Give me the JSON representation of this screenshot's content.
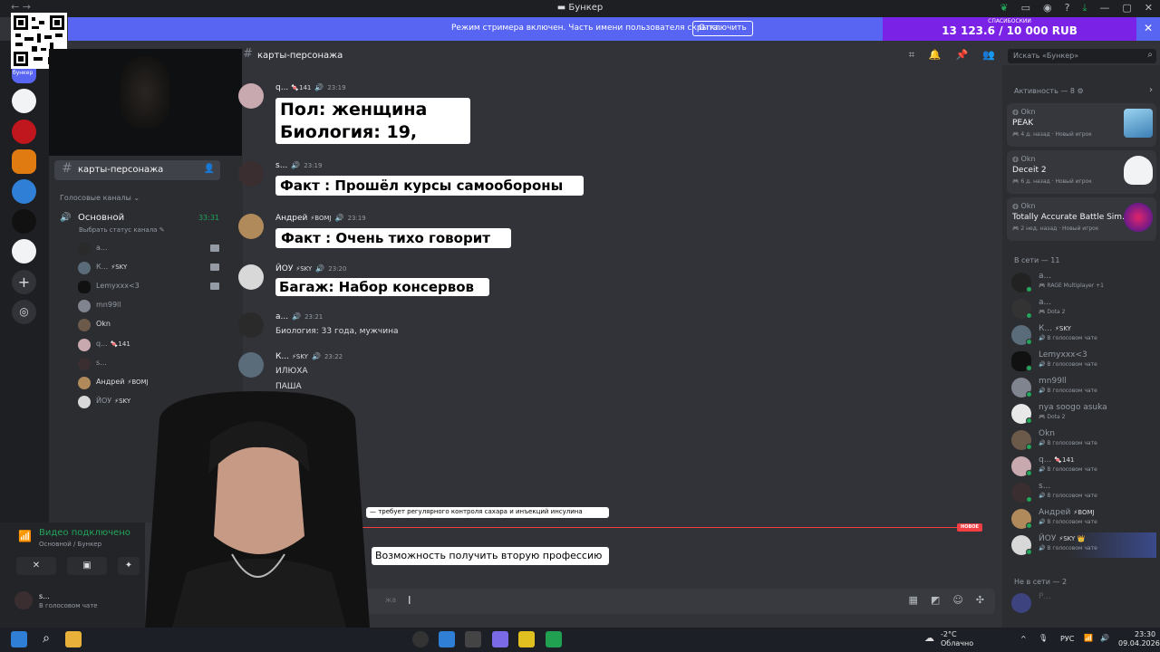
{
  "window": {
    "title": "Бункер"
  },
  "banner": {
    "text": "Режим стримера включен. Часть имени пользователя скрыта.",
    "button": "Отключить"
  },
  "donation": {
    "label": "СПАСИБОСКИИ",
    "amount": "13 123.6 / 10 000 RUB"
  },
  "qr_label": "бункер",
  "sidebar": {
    "active_channel": "карты-персонажа",
    "voice_category": "Голосовые каналы",
    "voice_channel": {
      "name": "Основной",
      "time": "33:31",
      "status_prompt": "Выбрать статус канала"
    },
    "voice_users": [
      {
        "name": "а...",
        "badge": ""
      },
      {
        "name": "К...",
        "badge": "⚡SKY"
      },
      {
        "name": "Lemyxxx<3",
        "badge": ""
      },
      {
        "name": "mn99ll",
        "badge": ""
      },
      {
        "name": "Okn",
        "badge": ""
      },
      {
        "name": "q...",
        "badge": "🍬141"
      },
      {
        "name": "s...",
        "badge": ""
      },
      {
        "name": "Андрей",
        "badge": "⚡BOMJ"
      },
      {
        "name": "ЙОУ",
        "badge": "⚡SKY"
      }
    ]
  },
  "voice_panel": {
    "status": "Видео подключено",
    "location": "Основной / Бункер",
    "user": "s...",
    "user_status": "В голосовом чате"
  },
  "channel_header": {
    "name": "карты-персонажа",
    "search_placeholder": "Искать «Бункер»"
  },
  "messages": [
    {
      "author": "q...",
      "badge": "🍬141",
      "time": "23:19",
      "lines": [
        "Пол: женщина",
        "Биология: 19,"
      ]
    },
    {
      "author": "s...",
      "badge": "",
      "time": "23:19",
      "lines": [
        "Факт : Прошёл курсы самообороны"
      ]
    },
    {
      "author": "Андрей",
      "badge": "⚡BOMJ",
      "time": "23:19",
      "lines": [
        "Факт : Очень тихо говорит"
      ]
    },
    {
      "author": "ЙОУ",
      "badge": "⚡SKY",
      "time": "23:20",
      "lines": [
        "Багаж: Набор консервов"
      ]
    },
    {
      "author": "а...",
      "badge": "",
      "time": "23:21",
      "lines": [
        "Биология: 33 года, мужчина"
      ]
    },
    {
      "author": "К...",
      "badge": "⚡SKY",
      "time": "23:22",
      "lines": [
        "ИЛЮХА",
        "ПАША"
      ]
    }
  ],
  "lower": {
    "partial_text": "— требует регулярного контроля сахара и инъекций инсулина",
    "new_label": "НОВОЕ",
    "card_text": "Возможность получить вторую профессию",
    "composer_placeholder": "жа"
  },
  "members": {
    "activity_header": "Активность — 8",
    "activities": [
      {
        "who": "Okn",
        "game": "PEAK",
        "meta": "4 д. назад",
        "tag": "Новый игрок"
      },
      {
        "who": "Okn",
        "game": "Deceit 2",
        "meta": "6 д. назад",
        "tag": "Новый игрок"
      },
      {
        "who": "Okn",
        "game": "Totally Accurate Battle Sim...",
        "meta": "2 нед. назад",
        "tag": "Новый игрок"
      }
    ],
    "online_header": "В сети — 11",
    "online": [
      {
        "name": "а...",
        "badge": "",
        "status": "RAGE Multiplayer +1"
      },
      {
        "name": "а...",
        "badge": "",
        "status": "Dota 2"
      },
      {
        "name": "К...",
        "badge": "⚡SKY",
        "status": "В голосовом чате"
      },
      {
        "name": "Lemyxxx<3",
        "badge": "",
        "status": "В голосовом чате"
      },
      {
        "name": "mn99ll",
        "badge": "",
        "status": "В голосовом чате"
      },
      {
        "name": "nya soogo asuka",
        "badge": "",
        "status": "Dota 2"
      },
      {
        "name": "Okn",
        "badge": "",
        "status": "В голосовом чате"
      },
      {
        "name": "q...",
        "badge": "🍬141",
        "status": "В голосовом чате"
      },
      {
        "name": "s...",
        "badge": "",
        "status": "В голосовом чате"
      },
      {
        "name": "Андрей",
        "badge": "⚡BOMJ",
        "status": "В голосовом чате"
      },
      {
        "name": "ЙОУ",
        "badge": "⚡SKY 👑",
        "status": "В голосовом чате"
      }
    ],
    "offline_header": "Не в сети — 2",
    "offline_first": "Р..."
  },
  "taskbar": {
    "temp": "-2°C",
    "weather": "Облачно",
    "lang": "РУС",
    "time": "23:30",
    "date": "09.04.2026"
  }
}
